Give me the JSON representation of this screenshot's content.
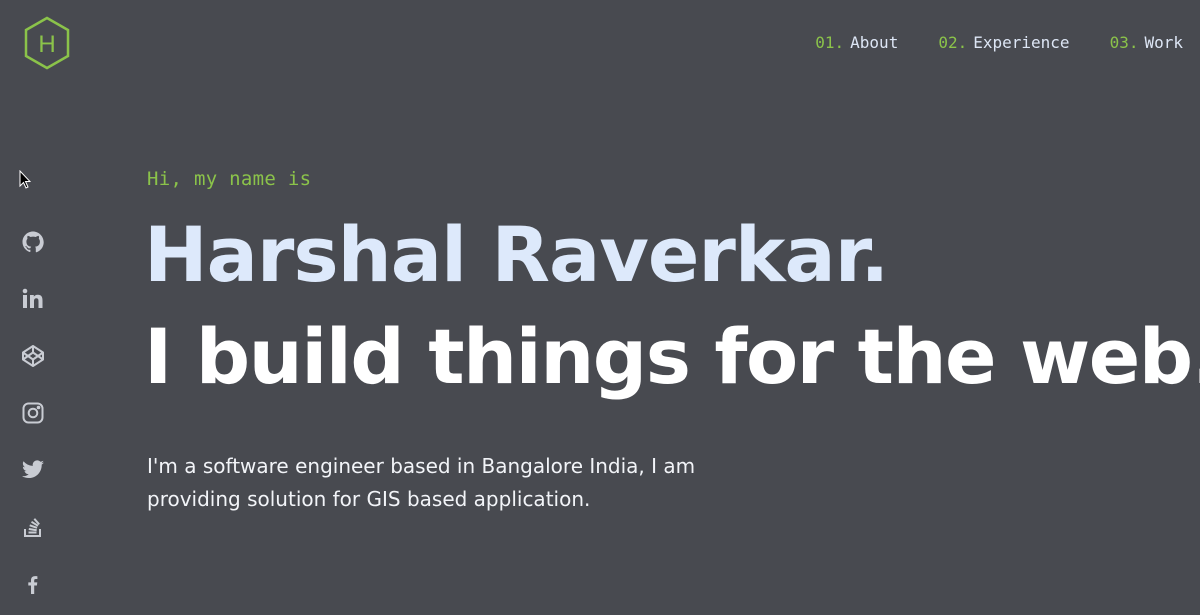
{
  "header": {
    "logo_letter": "H",
    "nav": [
      {
        "num": "01.",
        "label": "About"
      },
      {
        "num": "02.",
        "label": "Experience"
      },
      {
        "num": "03.",
        "label": "Work"
      }
    ]
  },
  "social": [
    {
      "icon": "github-icon"
    },
    {
      "icon": "linkedin-icon"
    },
    {
      "icon": "codepen-icon"
    },
    {
      "icon": "instagram-icon"
    },
    {
      "icon": "twitter-icon"
    },
    {
      "icon": "stackoverflow-icon"
    },
    {
      "icon": "facebook-icon"
    }
  ],
  "hero": {
    "greeting": "Hi, my name is",
    "name": "Harshal Raverkar.",
    "tagline": "I build things for the web.",
    "bio": "I'm a software engineer based in Bangalore India, I am providing solution for GIS based application."
  },
  "colors": {
    "background": "#484a50",
    "accent": "#8bc34a",
    "heading": "#dde9fb",
    "text": "#ffffff",
    "icon": "#c9ccd3"
  }
}
